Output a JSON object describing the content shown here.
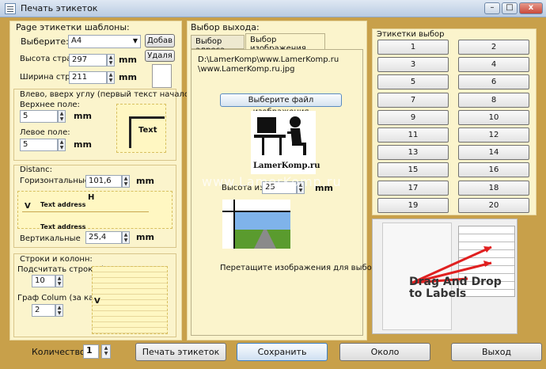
{
  "window": {
    "title": "Печать этикеток",
    "minimize": "–",
    "maximize": "□",
    "close": "x"
  },
  "left": {
    "templates_legend": "Page этикетки шаблоны:",
    "select_label": "Выберите:",
    "select_value": "A4",
    "add_button": "Добав",
    "delete_button": "Удаля",
    "height_label": "Высота страни",
    "height_value": "297",
    "width_label": "Ширина страни",
    "width_value": "211",
    "unit": "mm",
    "margins_legend": "Влево, вверх углу (первый текст начался):",
    "top_label": "Верхнее поле:",
    "top_value": "5",
    "left_label": "Левое поле:",
    "left_value": "5",
    "distance_legend": "Distanc:",
    "horizontal_label": "Горизонтальные",
    "horizontal_value": "101,6",
    "vertical_label": "Вертикальные",
    "vertical_value": "25,4",
    "rows_legend": "Строки и колонн:",
    "rows_label": "Подсчитать строки (на",
    "rows_value": "10",
    "cols_label": "Граф Colum (за кажду",
    "cols_value": "2",
    "preview_text": "Text",
    "preview_address": "Text address",
    "preview_H": "H",
    "preview_V": "V"
  },
  "middle": {
    "legend": "Выбор выхода:",
    "tab_address": "Выбор адреса",
    "tab_image": "Выбор изображения",
    "path_line1": "D:\\LamerKomp\\www.LamerKomp.ru",
    "path_line2": "\\www.LamerKomp.ru.jpg",
    "choose_button": "Выберите файл изображения",
    "logo_text": "LamerKomp.ru",
    "height_label": "Высота изоб",
    "height_value": "25",
    "unit": "mm",
    "drag_hint": "Перетащите изображения для выбора этик"
  },
  "right": {
    "legend": "Этикетки выбор",
    "labels": [
      "1",
      "2",
      "3",
      "4",
      "5",
      "6",
      "7",
      "8",
      "9",
      "10",
      "11",
      "12",
      "13",
      "14",
      "15",
      "16",
      "17",
      "18",
      "19",
      "20"
    ],
    "demo_caption": "Drag And Drop\nto Labels"
  },
  "bottom": {
    "count_label": "Количество ст",
    "count_value": "1",
    "print_button": "Печать этикеток",
    "save_button": "Сохранить",
    "about_button": "Около",
    "exit_button": "Выход"
  },
  "watermark": "www.LamerKomp.ru"
}
